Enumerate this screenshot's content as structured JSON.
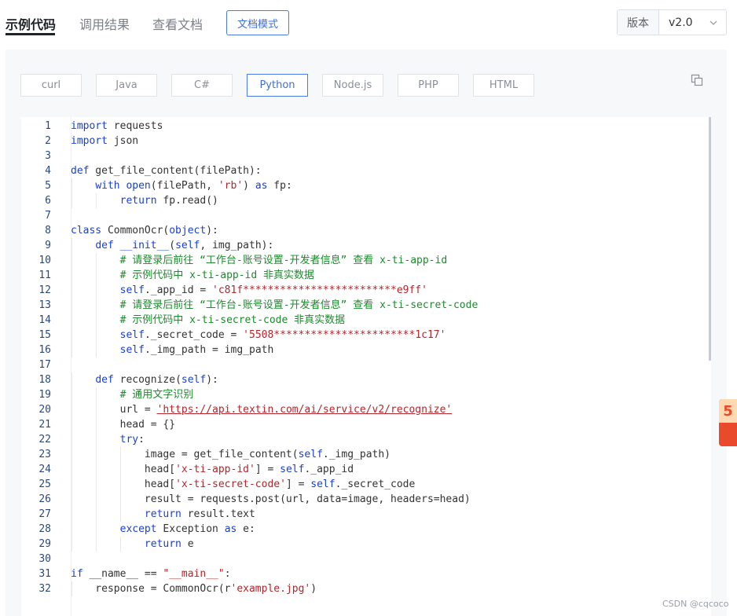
{
  "tabs": [
    {
      "label": "示例代码",
      "active": true
    },
    {
      "label": "调用结果",
      "active": false
    },
    {
      "label": "查看文档",
      "active": false
    }
  ],
  "mode_button": "文档模式",
  "version": {
    "label": "版本",
    "value": "v2.0"
  },
  "languages": [
    {
      "label": "curl",
      "active": false
    },
    {
      "label": "Java",
      "active": false
    },
    {
      "label": "C#",
      "active": false
    },
    {
      "label": "Python",
      "active": true
    },
    {
      "label": "Node.js",
      "active": false
    },
    {
      "label": "PHP",
      "active": false
    },
    {
      "label": "HTML",
      "active": false
    }
  ],
  "code_lines": [
    [
      {
        "t": "import",
        "c": "kw"
      },
      {
        "t": " requests"
      }
    ],
    [
      {
        "t": "import",
        "c": "kw"
      },
      {
        "t": " json"
      }
    ],
    [],
    [
      {
        "t": "def",
        "c": "kw"
      },
      {
        "t": " get_file_content(filePath):"
      }
    ],
    [
      {
        "t": "    "
      },
      {
        "t": "with",
        "c": "kw"
      },
      {
        "t": " "
      },
      {
        "t": "open",
        "c": "kw"
      },
      {
        "t": "(filePath, "
      },
      {
        "t": "'rb'",
        "c": "str"
      },
      {
        "t": ") "
      },
      {
        "t": "as",
        "c": "kw"
      },
      {
        "t": " fp:"
      }
    ],
    [
      {
        "t": "        "
      },
      {
        "t": "return",
        "c": "kw"
      },
      {
        "t": " fp.read()"
      }
    ],
    [],
    [
      {
        "t": "class",
        "c": "kw"
      },
      {
        "t": " CommonOcr("
      },
      {
        "t": "object",
        "c": "kw"
      },
      {
        "t": "):"
      }
    ],
    [
      {
        "t": "    "
      },
      {
        "t": "def",
        "c": "kw"
      },
      {
        "t": " "
      },
      {
        "t": "__init__",
        "c": "kw"
      },
      {
        "t": "("
      },
      {
        "t": "self",
        "c": "kw"
      },
      {
        "t": ", img_path):"
      }
    ],
    [
      {
        "t": "        "
      },
      {
        "t": "# 请登录后前往 “工作台-账号设置-开发者信息” 查看 x-ti-app-id",
        "c": "cmt"
      }
    ],
    [
      {
        "t": "        "
      },
      {
        "t": "# 示例代码中 x-ti-app-id 非真实数据",
        "c": "cmt"
      }
    ],
    [
      {
        "t": "        "
      },
      {
        "t": "self",
        "c": "kw"
      },
      {
        "t": "._app_id = "
      },
      {
        "t": "'c81f*************************e9ff'",
        "c": "str"
      }
    ],
    [
      {
        "t": "        "
      },
      {
        "t": "# 请登录后前往 “工作台-账号设置-开发者信息” 查看 x-ti-secret-code",
        "c": "cmt"
      }
    ],
    [
      {
        "t": "        "
      },
      {
        "t": "# 示例代码中 x-ti-secret-code 非真实数据",
        "c": "cmt"
      }
    ],
    [
      {
        "t": "        "
      },
      {
        "t": "self",
        "c": "kw"
      },
      {
        "t": "._secret_code = "
      },
      {
        "t": "'5508***********************1c17'",
        "c": "str"
      }
    ],
    [
      {
        "t": "        "
      },
      {
        "t": "self",
        "c": "kw"
      },
      {
        "t": "._img_path = img_path"
      }
    ],
    [],
    [
      {
        "t": "    "
      },
      {
        "t": "def",
        "c": "kw"
      },
      {
        "t": " recognize("
      },
      {
        "t": "self",
        "c": "kw"
      },
      {
        "t": "):"
      }
    ],
    [
      {
        "t": "        "
      },
      {
        "t": "# 通用文字识别",
        "c": "cmt"
      }
    ],
    [
      {
        "t": "        url = "
      },
      {
        "t": "'https://api.textin.com/ai/service/v2/recognize'",
        "c": "url"
      }
    ],
    [
      {
        "t": "        head = {}"
      }
    ],
    [
      {
        "t": "        "
      },
      {
        "t": "try",
        "c": "kw"
      },
      {
        "t": ":"
      }
    ],
    [
      {
        "t": "            image = get_file_content("
      },
      {
        "t": "self",
        "c": "kw"
      },
      {
        "t": "._img_path)"
      }
    ],
    [
      {
        "t": "            head["
      },
      {
        "t": "'x-ti-app-id'",
        "c": "str"
      },
      {
        "t": "] = "
      },
      {
        "t": "self",
        "c": "kw"
      },
      {
        "t": "._app_id"
      }
    ],
    [
      {
        "t": "            head["
      },
      {
        "t": "'x-ti-secret-code'",
        "c": "str"
      },
      {
        "t": "] = "
      },
      {
        "t": "self",
        "c": "kw"
      },
      {
        "t": "._secret_code"
      }
    ],
    [
      {
        "t": "            result = requests.post(url, data=image, headers=head)"
      }
    ],
    [
      {
        "t": "            "
      },
      {
        "t": "return",
        "c": "kw"
      },
      {
        "t": " result.text"
      }
    ],
    [
      {
        "t": "        "
      },
      {
        "t": "except",
        "c": "kw"
      },
      {
        "t": " Exception "
      },
      {
        "t": "as",
        "c": "kw"
      },
      {
        "t": " e:"
      }
    ],
    [
      {
        "t": "            "
      },
      {
        "t": "return",
        "c": "kw"
      },
      {
        "t": " e"
      }
    ],
    [],
    [
      {
        "t": "if",
        "c": "kw"
      },
      {
        "t": " __name__ == "
      },
      {
        "t": "\"__main__\"",
        "c": "str"
      },
      {
        "t": ":"
      }
    ],
    [
      {
        "t": "    response = CommonOcr(r"
      },
      {
        "t": "'example.jpg'",
        "c": "str"
      },
      {
        "t": ")"
      }
    ]
  ],
  "watermark": "CSDN @cqcoco",
  "floater_text": "5"
}
